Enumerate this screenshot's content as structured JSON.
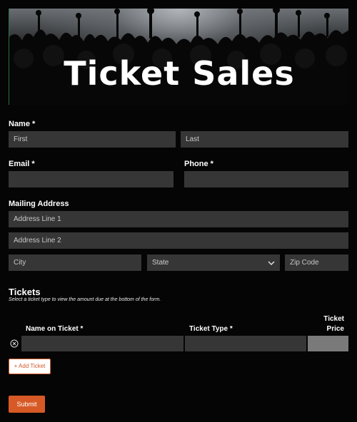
{
  "header": {
    "title": "Ticket Sales"
  },
  "form": {
    "name": {
      "label": "Name *",
      "first_placeholder": "First",
      "last_placeholder": "Last"
    },
    "email": {
      "label": "Email *"
    },
    "phone": {
      "label": "Phone *"
    },
    "address": {
      "label": "Mailing Address",
      "line1_placeholder": "Address Line 1",
      "line2_placeholder": "Address Line 2",
      "city_placeholder": "City",
      "state_value": "State",
      "zip_placeholder": "Zip Code"
    },
    "tickets": {
      "title": "Tickets",
      "subtitle": "Select a ticket type to view the amount due at the bottom of the form.",
      "columns": {
        "name": "Name on Ticket *",
        "type": "Ticket Type *",
        "price_line1": "Ticket",
        "price_line2": "Price"
      },
      "add_label": "+ Add Ticket"
    },
    "submit_label": "Submit"
  },
  "colors": {
    "accent": "#d75a26",
    "field_bg": "#363636",
    "page_bg": "#050505"
  },
  "icons": {
    "remove": "close-circle-icon",
    "dropdown": "chevron-down-icon",
    "add": "plus-icon"
  }
}
